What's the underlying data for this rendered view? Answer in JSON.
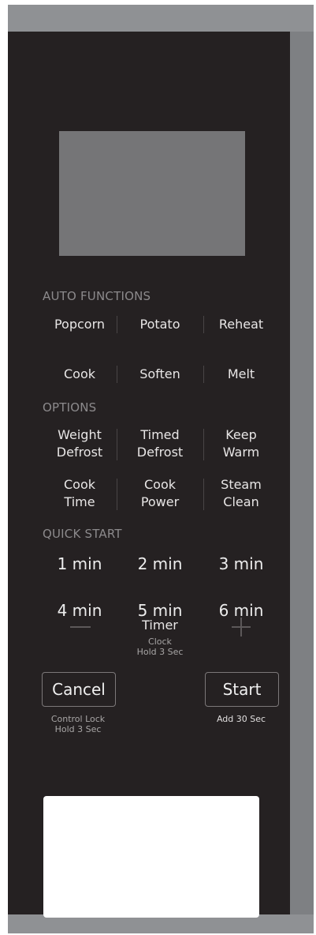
{
  "sections": {
    "auto_functions": "AUTO FUNCTIONS",
    "options": "OPTIONS",
    "quick_start": "QUICK START"
  },
  "auto": {
    "popcorn": "Popcorn",
    "potato": "Potato",
    "reheat": "Reheat",
    "cook": "Cook",
    "soften": "Soften",
    "melt": "Melt"
  },
  "options": {
    "weight_defrost": [
      "Weight",
      "Defrost"
    ],
    "timed_defrost": [
      "Timed",
      "Defrost"
    ],
    "keep_warm": [
      "Keep",
      "Warm"
    ],
    "cook_time": [
      "Cook",
      "Time"
    ],
    "cook_power": [
      "Cook",
      "Power"
    ],
    "steam_clean": [
      "Steam",
      "Clean"
    ]
  },
  "quick": {
    "m1": "1 min",
    "m2": "2 min",
    "m3": "3 min",
    "m4": "4 min",
    "m5": "5 min",
    "m6": "6 min"
  },
  "timer": {
    "label": "Timer",
    "sub1": "Clock",
    "sub2": "Hold 3 Sec"
  },
  "cancel": {
    "label": "Cancel",
    "sub1": "Control Lock",
    "sub2": "Hold 3 Sec"
  },
  "start": {
    "label": "Start",
    "sub": "Add 30 Sec"
  },
  "colors": {
    "panel": "#252122",
    "bezel": "#8f9194",
    "display": "#757577",
    "section_text": "#8c8a8c"
  }
}
